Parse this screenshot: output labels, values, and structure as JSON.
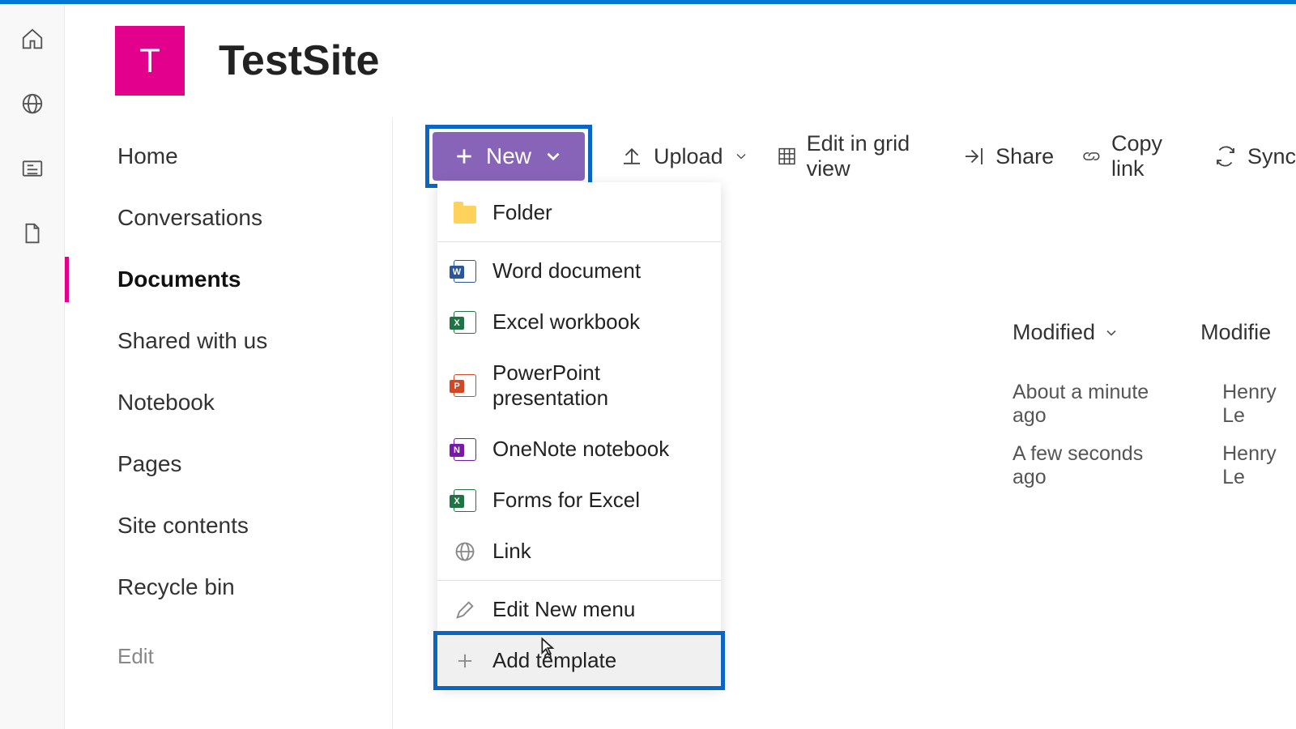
{
  "site": {
    "logo_letter": "T",
    "title": "TestSite"
  },
  "rail_icons": [
    "home",
    "globe",
    "news",
    "document"
  ],
  "left_nav": {
    "items": [
      {
        "label": "Home",
        "active": false
      },
      {
        "label": "Conversations",
        "active": false
      },
      {
        "label": "Documents",
        "active": true
      },
      {
        "label": "Shared with us",
        "active": false
      },
      {
        "label": "Notebook",
        "active": false
      },
      {
        "label": "Pages",
        "active": false
      },
      {
        "label": "Site contents",
        "active": false
      },
      {
        "label": "Recycle bin",
        "active": false
      }
    ],
    "edit_label": "Edit"
  },
  "command_bar": {
    "new_label": "New",
    "upload_label": "Upload",
    "edit_grid_label": "Edit in grid view",
    "share_label": "Share",
    "copy_link_label": "Copy link",
    "sync_label": "Sync"
  },
  "new_menu": {
    "items": [
      {
        "icon": "folder",
        "label": "Folder"
      },
      {
        "icon": "word",
        "label": "Word document",
        "tag": "W"
      },
      {
        "icon": "excel",
        "label": "Excel workbook",
        "tag": "X"
      },
      {
        "icon": "ppt",
        "label": "PowerPoint presentation",
        "tag": "P"
      },
      {
        "icon": "one",
        "label": "OneNote notebook",
        "tag": "N"
      },
      {
        "icon": "forms",
        "label": "Forms for Excel",
        "tag": "X"
      },
      {
        "icon": "link",
        "label": "Link"
      }
    ],
    "edit_menu_label": "Edit New menu",
    "add_template_label": "Add template"
  },
  "columns": {
    "modified": "Modified",
    "modified_by": "Modifie"
  },
  "rows": [
    {
      "modified": "About a minute ago",
      "modified_by": "Henry Le"
    },
    {
      "modified": "A few seconds ago",
      "modified_by": "Henry Le"
    }
  ]
}
